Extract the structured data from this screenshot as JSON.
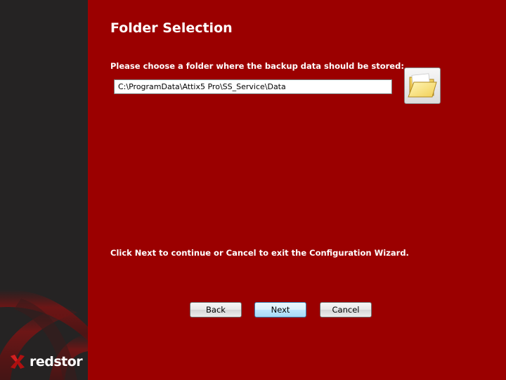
{
  "wizard": {
    "title": "Folder Selection",
    "prompt": "Please choose a folder where the backup data should be stored:",
    "path_value": "C:\\ProgramData\\Attix5 Pro\\SS_Service\\Data",
    "hint": "Click Next to continue or Cancel to exit the Configuration Wizard."
  },
  "buttons": {
    "back": "Back",
    "next": "Next",
    "cancel": "Cancel"
  },
  "brand": {
    "logo_text": "redstor",
    "accent": "#9b0000",
    "sidebar_color": "#252323"
  },
  "icons": {
    "browse": "folder-icon",
    "logo": "redstor-x-icon"
  }
}
